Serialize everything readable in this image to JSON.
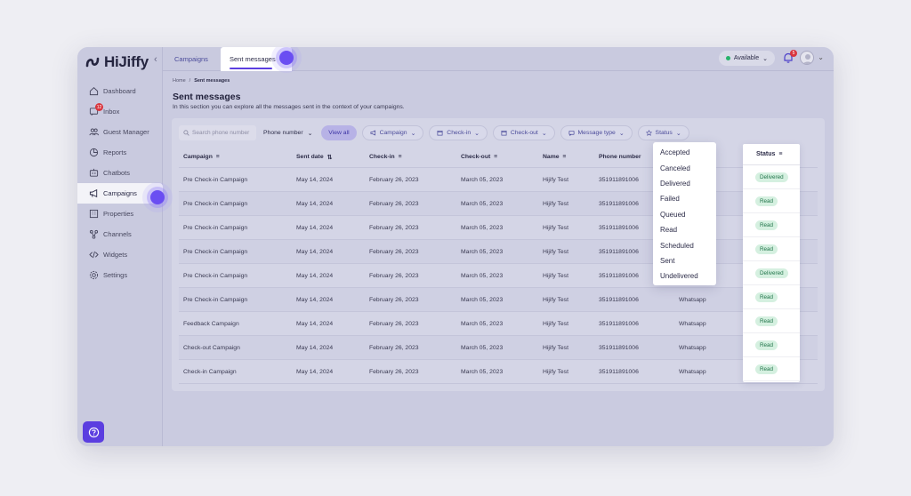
{
  "app": {
    "logo_text": "HiJiffy"
  },
  "sidebar": {
    "items": [
      {
        "label": "Dashboard",
        "icon": "home-icon"
      },
      {
        "label": "Inbox",
        "icon": "inbox-icon",
        "badge": "12"
      },
      {
        "label": "Guest Manager",
        "icon": "users-icon"
      },
      {
        "label": "Reports",
        "icon": "chart-icon"
      },
      {
        "label": "Chatbots",
        "icon": "chatbot-icon"
      },
      {
        "label": "Campaigns",
        "icon": "megaphone-icon",
        "active": true
      },
      {
        "label": "Properties",
        "icon": "building-icon"
      },
      {
        "label": "Channels",
        "icon": "channels-icon"
      },
      {
        "label": "Widgets",
        "icon": "code-icon"
      },
      {
        "label": "Settings",
        "icon": "gear-icon"
      }
    ]
  },
  "topbar": {
    "tabs": [
      {
        "label": "Campaigns"
      },
      {
        "label": "Sent messages"
      }
    ],
    "availability": "Available",
    "notification_count": "5"
  },
  "breadcrumb": {
    "home": "Home",
    "separator": "/",
    "current": "Sent messages"
  },
  "page": {
    "title": "Sent messages",
    "description": "In this section you can explore all the messages sent in the context of your campaigns."
  },
  "filters": {
    "search_placeholder": "Search phone number",
    "search_field": "Phone number",
    "view_all": "View all",
    "campaign": "Campaign",
    "checkin": "Check-in",
    "checkout": "Check-out",
    "message_type": "Message type",
    "status": "Status"
  },
  "table": {
    "columns": [
      "Campaign",
      "Sent date",
      "Check-in",
      "Check-out",
      "Name",
      "Phone number",
      "Status"
    ],
    "rows": [
      {
        "campaign": "Pre Check-in Campaign",
        "sent": "May 14, 2024",
        "checkin": "February 26, 2023",
        "checkout": "March 05, 2023",
        "name": "Hijify Test",
        "phone": "351911891006",
        "channel": "",
        "status": "Delivered"
      },
      {
        "campaign": "Pre Check-in Campaign",
        "sent": "May 14, 2024",
        "checkin": "February 26, 2023",
        "checkout": "March 05, 2023",
        "name": "Hijify Test",
        "phone": "351911891006",
        "channel": "",
        "status": "Read"
      },
      {
        "campaign": "Pre Check-in Campaign",
        "sent": "May 14, 2024",
        "checkin": "February 26, 2023",
        "checkout": "March 05, 2023",
        "name": "Hijify Test",
        "phone": "351911891006",
        "channel": "",
        "status": "Read"
      },
      {
        "campaign": "Pre Check-in Campaign",
        "sent": "May 14, 2024",
        "checkin": "February 26, 2023",
        "checkout": "March 05, 2023",
        "name": "Hijify Test",
        "phone": "351911891006",
        "channel": "",
        "status": "Read"
      },
      {
        "campaign": "Pre Check-in Campaign",
        "sent": "May 14, 2024",
        "checkin": "February 26, 2023",
        "checkout": "March 05, 2023",
        "name": "Hijify Test",
        "phone": "351911891006",
        "channel": "",
        "status": "Delivered"
      },
      {
        "campaign": "Pre Check-in Campaign",
        "sent": "May 14, 2024",
        "checkin": "February 26, 2023",
        "checkout": "March 05, 2023",
        "name": "Hijify Test",
        "phone": "351911891006",
        "channel": "Whatsapp",
        "status": "Read"
      },
      {
        "campaign": "Feedback Campaign",
        "sent": "May 14, 2024",
        "checkin": "February 26, 2023",
        "checkout": "March 05, 2023",
        "name": "Hijify Test",
        "phone": "351911891006",
        "channel": "Whatsapp",
        "status": "Read"
      },
      {
        "campaign": "Check-out Campaign",
        "sent": "May 14, 2024",
        "checkin": "February 26, 2023",
        "checkout": "March 05, 2023",
        "name": "Hijify Test",
        "phone": "351911891006",
        "channel": "Whatsapp",
        "status": "Read"
      },
      {
        "campaign": "Check-in Campaign",
        "sent": "May 14, 2024",
        "checkin": "February 26, 2023",
        "checkout": "March 05, 2023",
        "name": "Hijify Test",
        "phone": "351911891006",
        "channel": "Whatsapp",
        "status": "Read"
      }
    ]
  },
  "status_dropdown": {
    "options": [
      "Accepted",
      "Canceled",
      "Delivered",
      "Failed",
      "Queued",
      "Read",
      "Scheduled",
      "Sent",
      "Undelivered"
    ]
  },
  "colors": {
    "accent": "#5b3ee0",
    "status_green": "#21754a",
    "badge_red": "#d9363e"
  }
}
